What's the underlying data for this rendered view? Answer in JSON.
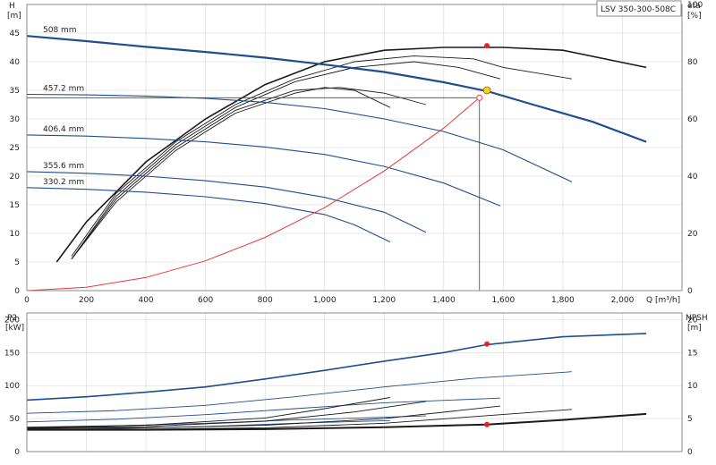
{
  "chart_data": {
    "type": "line",
    "title": "LSV 350-300-508C",
    "x": {
      "label": "Q [m³/h]",
      "range": [
        0,
        2200
      ],
      "ticks": [
        0,
        200,
        400,
        600,
        800,
        1000,
        1200,
        1400,
        1600,
        1800,
        2000
      ],
      "tick_labels": [
        "0",
        "200",
        "400",
        "600",
        "800",
        "1,000",
        "1,200",
        "1,400",
        "1,600",
        "1,800",
        "2,000"
      ]
    },
    "top_panel": {
      "y_left": {
        "label_line1": "H",
        "label_line2": "[m]",
        "range": [
          0,
          50
        ],
        "ticks": [
          0,
          5,
          10,
          15,
          20,
          25,
          30,
          35,
          40,
          45
        ]
      },
      "y_right": {
        "label_line1": "eta",
        "label_line2": "[%]",
        "range": [
          0,
          100
        ],
        "ticks": [
          0,
          20,
          40,
          60,
          80,
          100
        ]
      },
      "head_curves": [
        {
          "name": "508 mm",
          "style": "bold",
          "points": [
            [
              0,
              44.5
            ],
            [
              200,
              43.6
            ],
            [
              400,
              42.6
            ],
            [
              600,
              41.7
            ],
            [
              800,
              40.7
            ],
            [
              1000,
              39.5
            ],
            [
              1200,
              38.2
            ],
            [
              1400,
              36.4
            ],
            [
              1550,
              34.8
            ],
            [
              1700,
              32.5
            ],
            [
              1900,
              29.5
            ],
            [
              2080,
              26.0
            ]
          ]
        },
        {
          "name": "457.2 mm",
          "style": "thin",
          "points": [
            [
              0,
              34.3
            ],
            [
              200,
              34.2
            ],
            [
              400,
              34.0
            ],
            [
              600,
              33.6
            ],
            [
              800,
              32.9
            ],
            [
              1000,
              31.8
            ],
            [
              1200,
              30.0
            ],
            [
              1400,
              27.8
            ],
            [
              1600,
              24.6
            ],
            [
              1830,
              19.0
            ]
          ]
        },
        {
          "name": "406.4 mm",
          "style": "thin",
          "points": [
            [
              0,
              27.2
            ],
            [
              200,
              27.0
            ],
            [
              400,
              26.6
            ],
            [
              600,
              26.0
            ],
            [
              800,
              25.1
            ],
            [
              1000,
              23.8
            ],
            [
              1200,
              21.7
            ],
            [
              1400,
              18.8
            ],
            [
              1590,
              14.8
            ]
          ]
        },
        {
          "name": "355.6 mm",
          "style": "thin",
          "points": [
            [
              0,
              20.8
            ],
            [
              200,
              20.5
            ],
            [
              400,
              20.0
            ],
            [
              600,
              19.2
            ],
            [
              800,
              18.1
            ],
            [
              1000,
              16.3
            ],
            [
              1200,
              13.7
            ],
            [
              1340,
              10.2
            ]
          ]
        },
        {
          "name": "330.2 mm",
          "style": "thin",
          "points": [
            [
              0,
              18.0
            ],
            [
              200,
              17.7
            ],
            [
              400,
              17.2
            ],
            [
              600,
              16.4
            ],
            [
              800,
              15.2
            ],
            [
              1000,
              13.3
            ],
            [
              1100,
              11.5
            ],
            [
              1220,
              8.5
            ]
          ]
        }
      ],
      "efficiency_curves": [
        {
          "name": "",
          "points": [
            [
              100,
              10
            ],
            [
              200,
              24
            ],
            [
              400,
              45
            ],
            [
              600,
              60
            ],
            [
              800,
              72
            ],
            [
              1000,
              80
            ],
            [
              1200,
              84
            ],
            [
              1400,
              85
            ],
            [
              1600,
              85
            ],
            [
              1800,
              84
            ],
            [
              2080,
              78
            ]
          ]
        },
        {
          "name": "",
          "points": [
            [
              150,
              12
            ],
            [
              300,
              34
            ],
            [
              500,
              52
            ],
            [
              700,
              65
            ],
            [
              900,
              74
            ],
            [
              1100,
              80
            ],
            [
              1300,
              82
            ],
            [
              1500,
              81
            ],
            [
              1600,
              78
            ],
            [
              1830,
              74
            ]
          ]
        },
        {
          "name": "",
          "points": [
            [
              150,
              11
            ],
            [
              300,
              33
            ],
            [
              500,
              51
            ],
            [
              700,
              64
            ],
            [
              900,
              73
            ],
            [
              1100,
              78
            ],
            [
              1300,
              80
            ],
            [
              1450,
              78
            ],
            [
              1590,
              74
            ]
          ]
        },
        {
          "name": "",
          "points": [
            [
              150,
              11
            ],
            [
              300,
              32
            ],
            [
              500,
              50
            ],
            [
              700,
              63
            ],
            [
              900,
              70
            ],
            [
              1050,
              71
            ],
            [
              1200,
              69
            ],
            [
              1340,
              65
            ]
          ]
        },
        {
          "name": "",
          "points": [
            [
              150,
              11
            ],
            [
              300,
              31
            ],
            [
              500,
              49
            ],
            [
              700,
              62
            ],
            [
              900,
              69
            ],
            [
              1000,
              71
            ],
            [
              1100,
              70
            ],
            [
              1220,
              64
            ]
          ]
        }
      ],
      "system_curve": {
        "color": "#e23a3a",
        "points": [
          [
            0,
            0
          ],
          [
            200,
            0.6
          ],
          [
            400,
            2.3
          ],
          [
            600,
            5.2
          ],
          [
            800,
            9.3
          ],
          [
            1000,
            14.5
          ],
          [
            1200,
            20.9
          ],
          [
            1400,
            28.4
          ],
          [
            1520,
            33.7
          ]
        ]
      },
      "duty_point": {
        "q": 1545,
        "h": 35.0,
        "eta": 85.6
      },
      "system_point": {
        "q": 1520,
        "h": 33.7
      }
    },
    "bottom_panel": {
      "y_left": {
        "label_line1": "P2",
        "label_line2": "[kW]",
        "range": [
          0,
          210
        ],
        "ticks": [
          0,
          50,
          100,
          150,
          200
        ]
      },
      "y_right": {
        "label_line1": "NPSH",
        "label_line2": "[m]",
        "range": [
          0,
          21
        ],
        "ticks": [
          0,
          5,
          10,
          15,
          20
        ]
      },
      "power_curves": [
        {
          "name": "",
          "style": "bold",
          "points": [
            [
              0,
              78
            ],
            [
              200,
              83
            ],
            [
              400,
              90
            ],
            [
              600,
              98
            ],
            [
              800,
              110
            ],
            [
              1000,
              123
            ],
            [
              1200,
              137
            ],
            [
              1400,
              150
            ],
            [
              1545,
              162
            ],
            [
              1800,
              174
            ],
            [
              2080,
              179
            ]
          ]
        },
        {
          "name": "",
          "style": "thin",
          "points": [
            [
              0,
              58
            ],
            [
              300,
              62
            ],
            [
              600,
              70
            ],
            [
              900,
              83
            ],
            [
              1200,
              98
            ],
            [
              1500,
              111
            ],
            [
              1830,
              121
            ]
          ]
        },
        {
          "name": "",
          "style": "thin",
          "points": [
            [
              0,
              45
            ],
            [
              300,
              49
            ],
            [
              600,
              56
            ],
            [
              900,
              65
            ],
            [
              1200,
              74
            ],
            [
              1590,
              81
            ]
          ]
        },
        {
          "name": "",
          "style": "thin",
          "points": [
            [
              0,
              36
            ],
            [
              300,
              39
            ],
            [
              600,
              43
            ],
            [
              900,
              48
            ],
            [
              1200,
              52
            ],
            [
              1340,
              54
            ]
          ]
        },
        {
          "name": "",
          "style": "thin",
          "points": [
            [
              0,
              33
            ],
            [
              300,
              35
            ],
            [
              600,
              38
            ],
            [
              900,
              43
            ],
            [
              1220,
              47
            ]
          ]
        }
      ],
      "npsh_curves": [
        {
          "name": "",
          "style": "bold",
          "points": [
            [
              0,
              3.3
            ],
            [
              400,
              3.3
            ],
            [
              800,
              3.4
            ],
            [
              1200,
              3.7
            ],
            [
              1545,
              4.1
            ],
            [
              1800,
              4.8
            ],
            [
              2080,
              5.7
            ]
          ]
        },
        {
          "name": "",
          "style": "thin",
          "points": [
            [
              0,
              3.4
            ],
            [
              400,
              3.4
            ],
            [
              800,
              3.6
            ],
            [
              1200,
              4.3
            ],
            [
              1500,
              5.3
            ],
            [
              1830,
              6.4
            ]
          ]
        },
        {
          "name": "",
          "style": "thin",
          "points": [
            [
              0,
              3.5
            ],
            [
              400,
              3.6
            ],
            [
              800,
              4.0
            ],
            [
              1200,
              5.0
            ],
            [
              1590,
              6.9
            ]
          ]
        },
        {
          "name": "",
          "style": "thin",
          "points": [
            [
              0,
              3.6
            ],
            [
              400,
              3.8
            ],
            [
              800,
              4.6
            ],
            [
              1100,
              6.0
            ],
            [
              1340,
              7.6
            ]
          ]
        },
        {
          "name": "",
          "style": "thin",
          "points": [
            [
              0,
              3.7
            ],
            [
              400,
              4.0
            ],
            [
              800,
              5.1
            ],
            [
              1000,
              6.5
            ],
            [
              1220,
              8.2
            ]
          ]
        }
      ],
      "power_point": {
        "q": 1545,
        "p2": 163
      },
      "npsh_point": {
        "q": 1545,
        "npsh": 4.1
      }
    },
    "colors": {
      "head": "#1f4e8c",
      "efficiency": "#1a1a1a",
      "system": "#e23a3a",
      "duty": "#f6d21a",
      "marker": "#e52323",
      "frame": "#888888",
      "grid": "#d6d6d6"
    }
  }
}
